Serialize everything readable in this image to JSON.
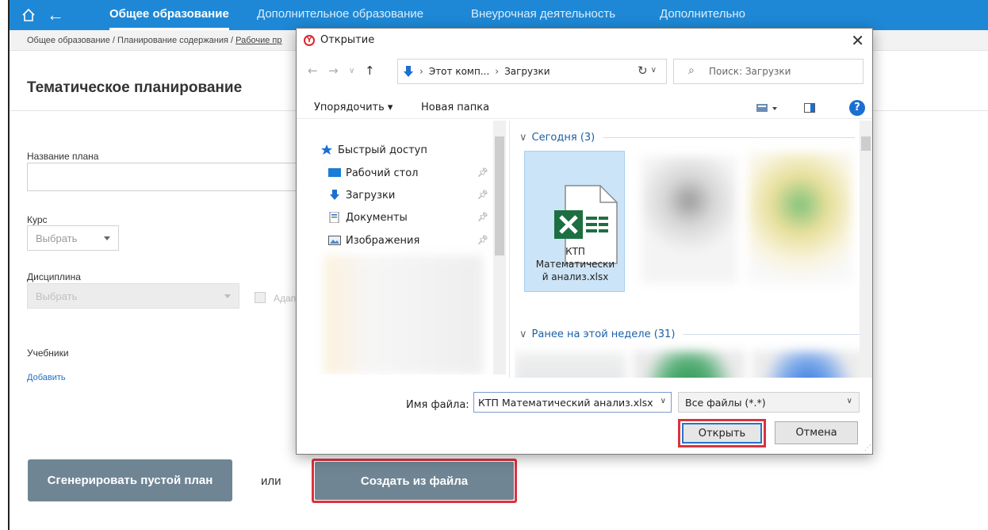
{
  "topnav": {
    "tabs": [
      "Общее образование",
      "Дополнительное образование",
      "Внеурочная деятельность",
      "Дополнительно"
    ],
    "active_tab": "Общее образование"
  },
  "breadcrumb": {
    "items": [
      "Общее образование",
      "Планирование содержания",
      "Рабочие пр"
    ]
  },
  "page": {
    "title": "Тематическое планирование",
    "fields": {
      "plan_name_label": "Название плана",
      "plan_name_value": "",
      "course_label": "Курс",
      "course_value": "Выбрать",
      "discipline_label": "Дисциплина",
      "discipline_value": "Выбрать",
      "adapted_checkbox_label": "Адап",
      "textbooks_label": "Учебники",
      "add_link": "Добавить"
    },
    "buttons": {
      "generate_empty": "Сгенерировать пустой план",
      "or": "или",
      "create_from_file": "Создать из файла"
    }
  },
  "dialog": {
    "title": "Открытие",
    "address": {
      "segments": [
        "Этот комп...",
        "Загрузки"
      ]
    },
    "search_placeholder": "Поиск: Загрузки",
    "toolbar": {
      "organize": "Упорядочить ▾",
      "new_folder": "Новая папка"
    },
    "nav": {
      "quick_access": "Быстрый доступ",
      "items": [
        "Рабочий стол",
        "Загрузки",
        "Документы",
        "Изображения"
      ]
    },
    "groups": {
      "today": "Сегодня (3)",
      "this_week": "Ранее на этой неделе (31)"
    },
    "selected_file": {
      "name": "КТП Математический анализ.xlsx",
      "name_wrapped": [
        "КТП",
        "Математически",
        "й анализ.xlsx"
      ]
    },
    "filename_label": "Имя файла:",
    "filename_value": "КТП Математический анализ.xlsx",
    "filetype_value": "Все файлы (*.*)",
    "open_button": "Открыть",
    "cancel_button": "Отмена"
  },
  "colors": {
    "nav_blue": "#1e88d6",
    "button_slate": "#6f8594",
    "highlight_red": "#d9333f",
    "excel_green": "#1d6f42",
    "link_blue": "#1e6fc9"
  }
}
